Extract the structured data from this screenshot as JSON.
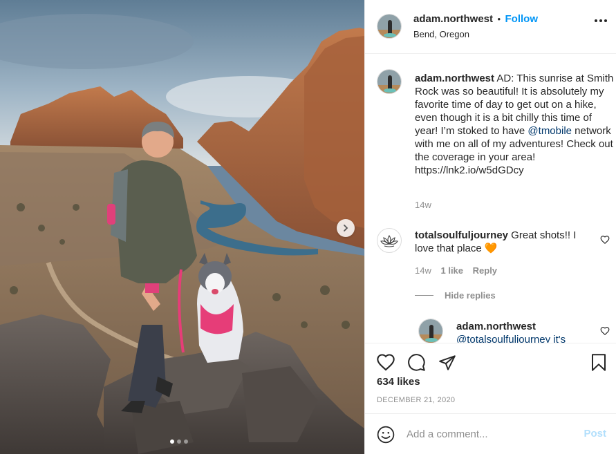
{
  "post": {
    "username": "adam.northwest",
    "separator": "•",
    "follow_label": "Follow",
    "location": "Bend, Oregon"
  },
  "caption": {
    "username": "adam.northwest",
    "text_before_mention": "AD: This sunrise at Smith Rock was so beautiful! It is absolutely my favorite time of day to get out on a hike, even though it is a bit chilly this time of year! I’m stoked to have ",
    "mention": "@tmobile",
    "text_after_mention": " network with me on all of my adventures! Check out the coverage in your area! https://lnk2.io/w5dGDcy",
    "age": "14w"
  },
  "comments": [
    {
      "username": "totalsoulfuljourney",
      "text": "Great shots!! I love that place 🧡",
      "age": "14w",
      "likes": "1 like",
      "reply_label": "Reply",
      "hide_replies_label": "Hide replies"
    }
  ],
  "reply": {
    "username": "adam.northwest",
    "text_partial": "@totalsoulfuljourney it's"
  },
  "engagement": {
    "likes": "634 likes",
    "date": "DECEMBER 21, 2020"
  },
  "composer": {
    "placeholder": "Add a comment...",
    "post_label": "Post"
  },
  "carousel": {
    "total": 3,
    "active": 1
  },
  "icons": {
    "like": "heart-icon",
    "comment": "comment-icon",
    "share": "paper-plane-icon",
    "save": "bookmark-icon",
    "emoji": "emoji-icon",
    "next": "chevron-right-icon",
    "more": "more-options-icon"
  },
  "colors": {
    "follow": "#0095f6",
    "post_disabled": "#b2dffc",
    "muted": "#8e8e8e",
    "mention": "#00376b"
  }
}
